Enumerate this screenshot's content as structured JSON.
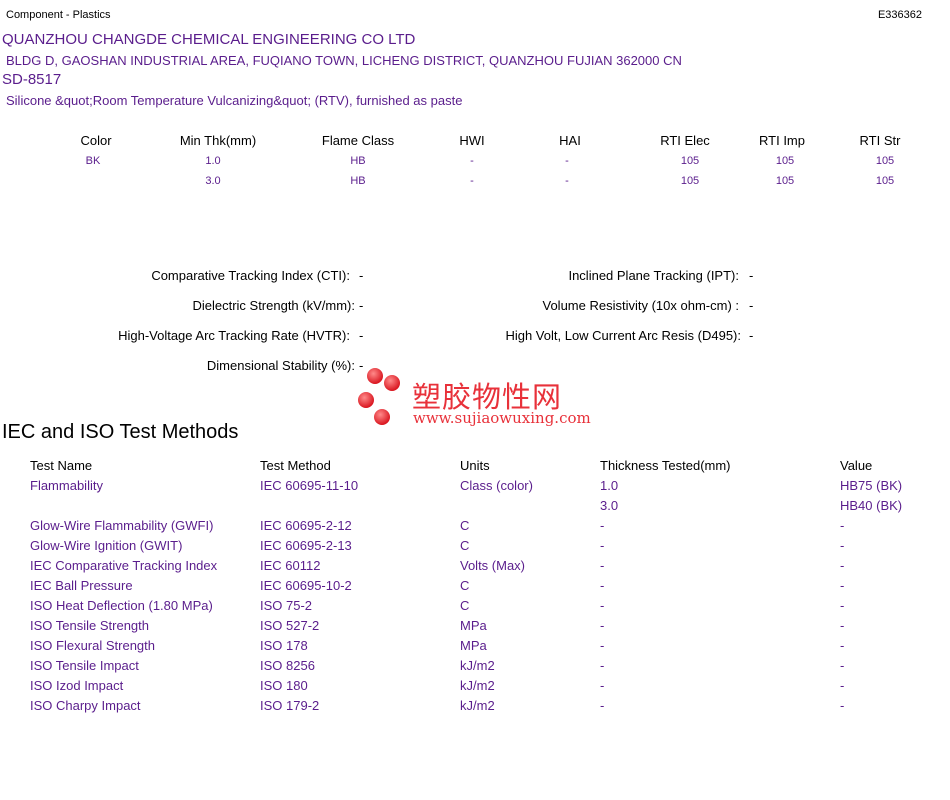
{
  "header": {
    "category": "Component - Plastics",
    "file_number": "E336362"
  },
  "company": {
    "name": "QUANZHOU CHANGDE CHEMICAL ENGINEERING CO LTD",
    "address": "BLDG D, GAOSHAN INDUSTRIAL AREA, FUQIANO TOWN, LICHENG DISTRICT, QUANZHOU  FUJIAN  362000 CN",
    "product": "SD-8517",
    "description": "Silicone &quot;Room Temperature Vulcanizing&quot; (RTV), furnished as paste"
  },
  "ratings": {
    "headers": [
      "Color",
      "Min Thk(mm)",
      "Flame Class",
      "HWI",
      "HAI",
      "RTI Elec",
      "RTI Imp",
      "RTI Str"
    ],
    "rows": [
      [
        "BK",
        "1.0",
        "HB",
        "-",
        "-",
        "105",
        "105",
        "105"
      ],
      [
        "",
        "3.0",
        "HB",
        "-",
        "-",
        "105",
        "105",
        "105"
      ]
    ]
  },
  "properties": {
    "left": [
      {
        "label": "Comparative Tracking Index (CTI):",
        "value": "-"
      },
      {
        "label": "Dielectric Strength (kV/mm):",
        "value": "-"
      },
      {
        "label": "High-Voltage Arc Tracking Rate (HVTR):",
        "value": "-"
      },
      {
        "label": "Dimensional Stability (%):",
        "value": "-"
      }
    ],
    "right": [
      {
        "label": "Inclined Plane Tracking (IPT):",
        "value": "-"
      },
      {
        "label": "Volume Resistivity (10x ohm-cm) :",
        "value": "-"
      },
      {
        "label": "High Volt, Low Current Arc Resis (D495):",
        "value": "-"
      }
    ]
  },
  "watermark": {
    "chinese": "塑胶物性网",
    "url": "www.sujiaowuxing.com",
    "color": "#e8313a"
  },
  "test_methods": {
    "title": "IEC and ISO Test Methods",
    "headers": [
      "Test Name",
      "Test Method",
      "Units",
      "Thickness Tested(mm)",
      "Value"
    ],
    "rows": [
      [
        "Flammability",
        "IEC 60695-11-10",
        "Class (color)",
        "1.0",
        "HB75 (BK)"
      ],
      [
        "",
        "",
        "",
        "3.0",
        "HB40 (BK)"
      ],
      [
        "Glow-Wire Flammability (GWFI)",
        "IEC 60695-2-12",
        "C",
        "-",
        "-"
      ],
      [
        "Glow-Wire Ignition (GWIT)",
        "IEC 60695-2-13",
        "C",
        "-",
        "-"
      ],
      [
        "IEC Comparative Tracking Index",
        "IEC 60112",
        "Volts (Max)",
        "-",
        "-"
      ],
      [
        "IEC Ball Pressure",
        "IEC 60695-10-2",
        "C",
        "-",
        "-"
      ],
      [
        "ISO Heat Deflection (1.80 MPa)",
        "ISO 75-2",
        "C",
        "-",
        "-"
      ],
      [
        "ISO Tensile Strength",
        "ISO 527-2",
        "MPa",
        "-",
        "-"
      ],
      [
        "ISO Flexural Strength",
        "ISO 178",
        "MPa",
        "-",
        "-"
      ],
      [
        "ISO Tensile Impact",
        "ISO 8256",
        "kJ/m2",
        "-",
        "-"
      ],
      [
        "ISO Izod Impact",
        "ISO 180",
        "kJ/m2",
        "-",
        "-"
      ],
      [
        "ISO Charpy Impact",
        "ISO 179-2",
        "kJ/m2",
        "-",
        "-"
      ]
    ]
  }
}
